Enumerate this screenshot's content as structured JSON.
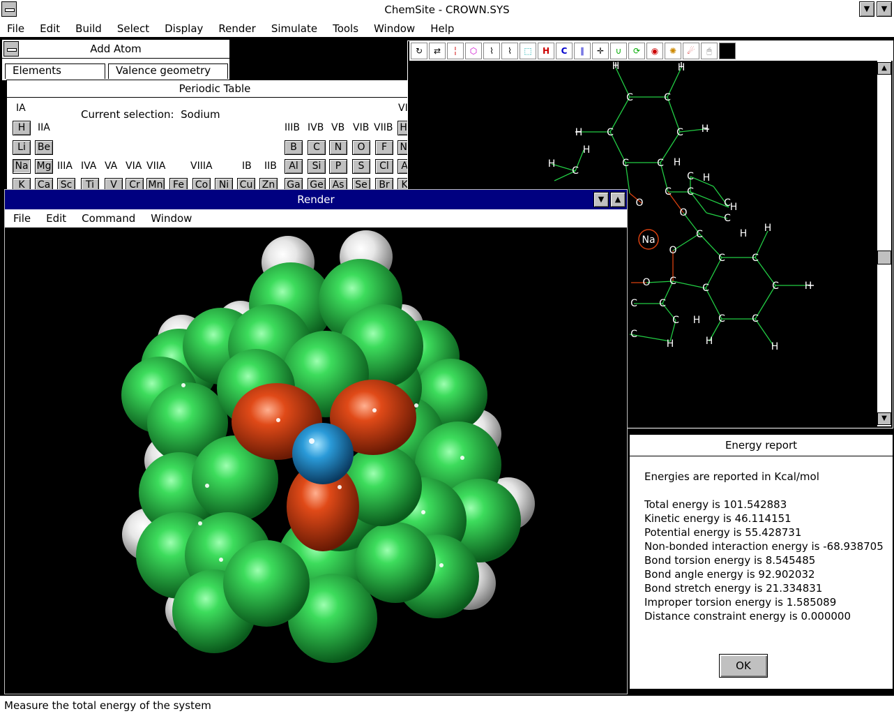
{
  "app": {
    "title": "ChemSite - CROWN.SYS"
  },
  "menu": [
    "File",
    "Edit",
    "Build",
    "Select",
    "Display",
    "Render",
    "Simulate",
    "Tools",
    "Window",
    "Help"
  ],
  "add_atom": {
    "title": "Add Atom",
    "tabs": [
      "Elements",
      "Valence geometry"
    ],
    "periodic_title": "Periodic Table",
    "current_selection_label": "Current selection:",
    "current_selection": "Sodium",
    "group_labels": [
      "IA",
      "IIA",
      "IIIB",
      "IVB",
      "VB",
      "VIB",
      "VIIB",
      "VIII",
      "IIIA",
      "IVA",
      "VA",
      "VIA",
      "VIIA",
      "VIIIA",
      "IB",
      "IIB"
    ],
    "row1": [
      "H",
      "He"
    ],
    "row2": [
      "Li",
      "Be",
      "B",
      "C",
      "N",
      "O",
      "F",
      "Ne"
    ],
    "row3": [
      "Na",
      "Mg",
      "Al",
      "Si",
      "P",
      "S",
      "Cl",
      "Ar"
    ],
    "row4": [
      "K",
      "Ca",
      "Sc",
      "Ti",
      "V",
      "Cr",
      "Mn",
      "Fe",
      "Co",
      "Ni",
      "Cu",
      "Zn",
      "Ga",
      "Ge",
      "As",
      "Se",
      "Br",
      "Kr"
    ]
  },
  "render": {
    "title": "Render",
    "menu": [
      "File",
      "Edit",
      "Command",
      "Window"
    ]
  },
  "molecule": {
    "na_label": "Na",
    "atom_c": "C",
    "atom_h": "H",
    "atom_o": "O"
  },
  "energy": {
    "title": "Energy report",
    "units_note": "Energies are reported in Kcal/mol",
    "lines": [
      "Total energy is 101.542883",
      "Kinetic energy is 46.114151",
      "Potential energy is 55.428731",
      "Non-bonded interaction energy is -68.938705",
      "Bond torsion energy is 8.545485",
      "Bond angle energy is 92.902032",
      "Bond stretch energy is 21.334831",
      "Improper torsion energy is 1.585089",
      "Distance constraint energy is 0.000000"
    ],
    "ok_label": "OK"
  },
  "status": {
    "text": "Measure the total energy of the system"
  },
  "colors": {
    "carbon": "#22cc44",
    "oxygen": "#d9400f",
    "sodium": "#2a8fd0",
    "hydrogen": "#f0f0f0",
    "render_title": "#000080"
  }
}
